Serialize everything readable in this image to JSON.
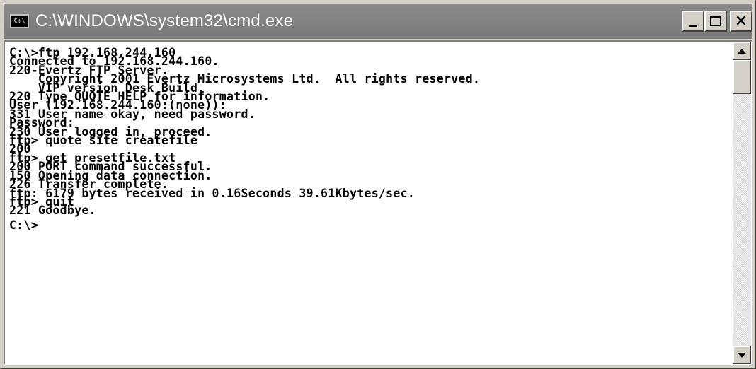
{
  "window": {
    "title": "C:\\WINDOWS\\system32\\cmd.exe",
    "icon_name": "cmd-icon",
    "icon_text": "C:\\"
  },
  "caption_buttons": {
    "minimize_icon": "minimize-icon",
    "maximize_icon": "maximize-icon",
    "close_icon": "close-icon",
    "close_glyph": "×"
  },
  "console": {
    "lines": [
      "C:\\>ftp 192.168.244.160",
      "Connected to 192.168.244.160.",
      "220-Evertz FTP Server.",
      "    Copyright 2001 Evertz Microsystems Ltd.  All rights reserved.",
      "    VIP version Desk Build.",
      "220 Type QUOTE HELP for information.",
      "User (192.168.244.160:(none)):",
      "331 User name okay, need password.",
      "Password:",
      "230 User logged in, proceed.",
      "ftp> quote site createfile",
      "200",
      "ftp> get presetfile.txt",
      "200 PORT command successful.",
      "150 Opening data connection.",
      "226 Transfer complete.",
      "ftp: 6179 bytes received in 0.16Seconds 39.61Kbytes/sec.",
      "ftp> quit",
      "221 Goodbye.",
      "",
      "C:\\>"
    ]
  },
  "scrollbar": {
    "up_icon": "scroll-up-arrow-icon",
    "down_icon": "scroll-down-arrow-icon"
  },
  "colors": {
    "titlebar": "#7a7a7a",
    "console_bg": "#ffffff",
    "console_text": "#000000"
  }
}
